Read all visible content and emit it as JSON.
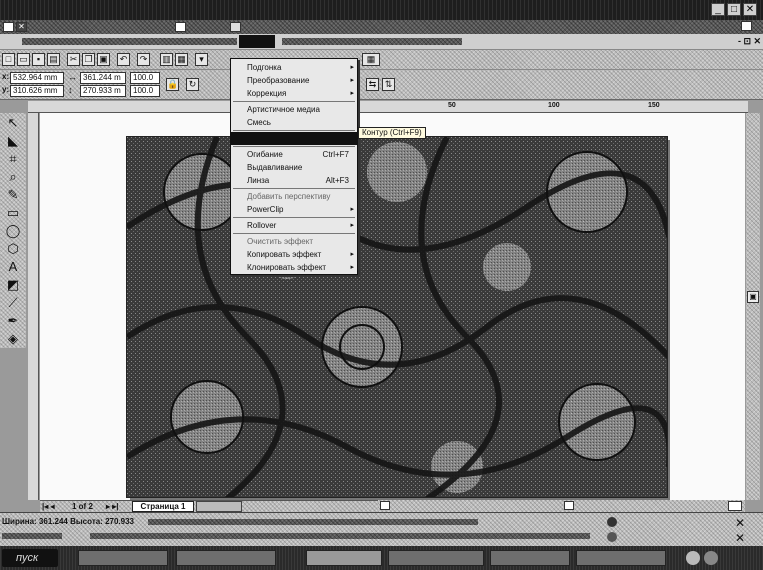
{
  "effects_menu": {
    "items": [
      {
        "label": "Подгонка",
        "arrow": true
      },
      {
        "label": "Преобразование",
        "arrow": true
      },
      {
        "label": "Коррекция",
        "arrow": true
      },
      {
        "sep": true
      },
      {
        "label": "Артистичное медиа"
      },
      {
        "label": "Смесь"
      },
      {
        "sep": true
      },
      {
        "label": "",
        "highlight": true
      },
      {
        "sep": true
      },
      {
        "label": "Огибание",
        "shortcut": "Ctrl+F7"
      },
      {
        "label": "Выдавливание"
      },
      {
        "label": "Линза",
        "shortcut": "Alt+F3"
      },
      {
        "sep": true
      },
      {
        "label": "Добавить перспективу",
        "dim": true
      },
      {
        "label": "PowerClip",
        "arrow": true
      },
      {
        "sep": true
      },
      {
        "label": "Rollover",
        "arrow": true
      },
      {
        "sep": true
      },
      {
        "label": "Очистить эффект",
        "dim": true
      },
      {
        "label": "Копировать эффект",
        "arrow": true
      },
      {
        "label": "Клонировать эффект",
        "arrow": true
      }
    ]
  },
  "tooltip": "Контур (Ctrl+F9)",
  "propbar": {
    "x": "532.964 mm",
    "y": "310.626 mm",
    "w": "361.244 m",
    "h": "270.933 m",
    "sx": "100.0",
    "sy": "100.0"
  },
  "ruler_labels": [
    "50",
    "100",
    "150"
  ],
  "pagenav": {
    "counter": "1 of 2",
    "page_tab": "Страница 1"
  },
  "status": {
    "line1_prefix": "Ширина: 361.244 Высота: 270.933"
  },
  "colors": {
    "menu_highlight": "#111111",
    "workspace": "#fafafa"
  }
}
